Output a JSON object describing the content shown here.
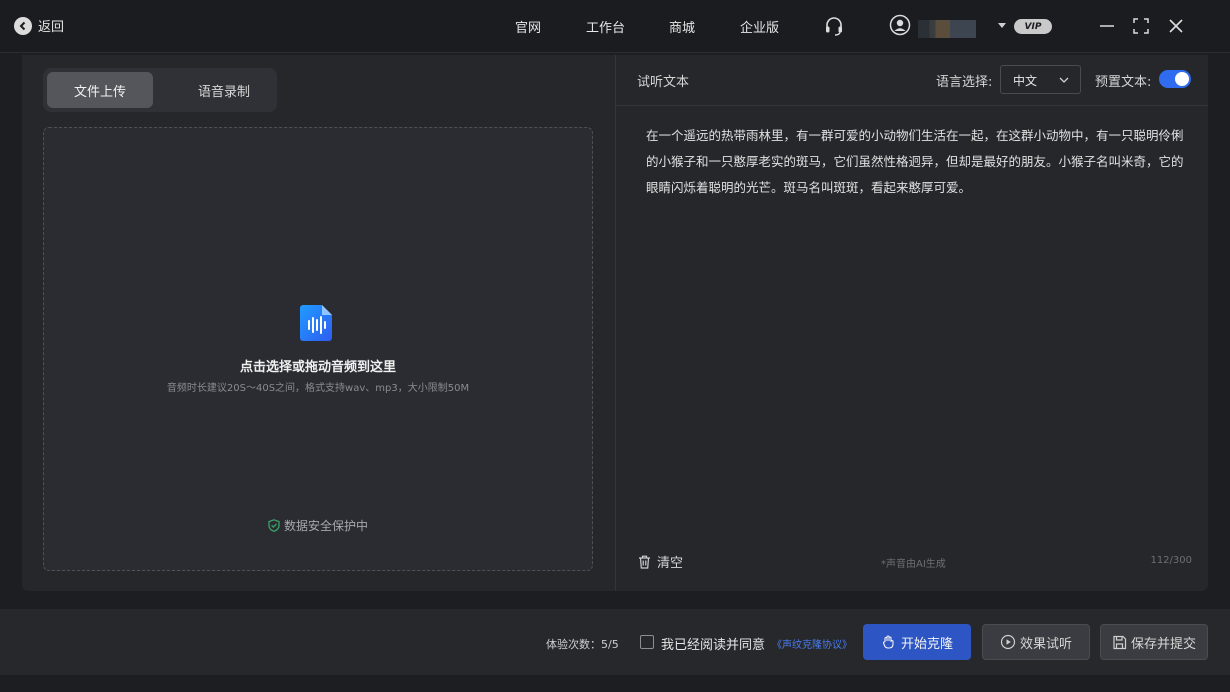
{
  "titlebar": {
    "back_label": "返回",
    "nav": [
      "官网",
      "工作台",
      "商城",
      "企业版"
    ],
    "user_name": "",
    "vip_badge": "VIP"
  },
  "left_panel": {
    "tabs": [
      {
        "label": "文件上传",
        "active": true
      },
      {
        "label": "语音录制",
        "active": false
      }
    ],
    "dropzone": {
      "title": "点击选择或拖动音频到这里",
      "hint": "音频时长建议20S～40S之间，格式支持wav、mp3，大小限制50M"
    },
    "security_note": "数据安全保护中"
  },
  "right_panel": {
    "title": "试听文本",
    "language_label": "语言选择:",
    "language_value": "中文",
    "preset_label": "预置文本:",
    "preset_enabled": true,
    "text": "在一个遥远的热带雨林里，有一群可爱的小动物们生活在一起，在这群小动物中，有一只聪明伶俐的小猴子和一只憨厚老实的斑马，它们虽然性格迥异，但却是最好的朋友。小猴子名叫米奇，它的眼睛闪烁着聪明的光芒。斑马名叫斑斑，看起来憨厚可爱。",
    "clear_label": "清空",
    "ai_note": "*声音由AI生成",
    "char_count": "112/300"
  },
  "bottom_bar": {
    "trial_count": "体验次数：5/5",
    "agree_text": "我已经阅读并同意",
    "agree_link": "《声纹克隆协议》",
    "start_label": "开始克隆",
    "try_label": "效果试听",
    "save_label": "保存并提交"
  },
  "colors": {
    "accent": "#2f6cf0",
    "primary_button": "#2d56c4",
    "security_green": "#3aa36a",
    "link": "#4a7df0"
  },
  "icons": [
    "back-arrow-icon",
    "headset-icon",
    "user-icon",
    "minimize-icon",
    "maximize-icon",
    "close-icon",
    "audio-file-icon",
    "shield-icon",
    "trash-icon",
    "chevron-down-icon",
    "hand-icon",
    "play-icon",
    "save-icon"
  ]
}
